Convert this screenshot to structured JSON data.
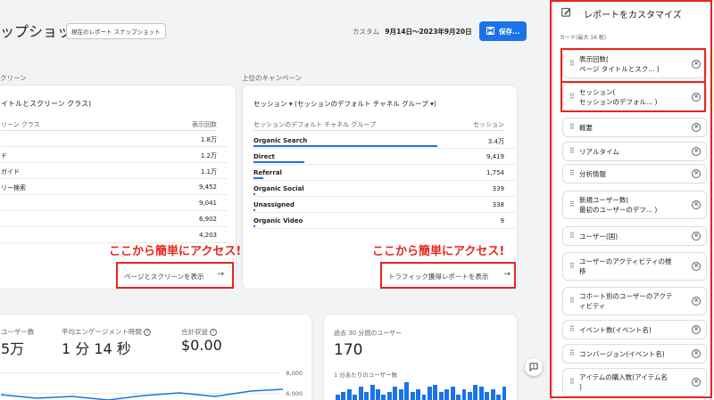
{
  "header": {
    "title": "ップショット",
    "chip": "現在のレポート スナップショット",
    "date_prefix": "カスタム",
    "date_range": "9月14日～2023年9月20日",
    "save_label": "保存..."
  },
  "pages_card": {
    "section_label": "クリーン",
    "metric_title": "イトルとスクリーン クラス)",
    "col_left": "リーン クラス",
    "col_right": "表示回数",
    "rows": [
      {
        "label": "",
        "value": "1.8万"
      },
      {
        "label": "ド",
        "value": "1.2万"
      },
      {
        "label": "ガイド",
        "value": "1.1万"
      },
      {
        "label": "リー検索",
        "value": "9,452"
      },
      {
        "label": "",
        "value": "9,041"
      },
      {
        "label": "",
        "value": "6,902"
      },
      {
        "label": "",
        "value": "4,203"
      }
    ],
    "link_label": "ページとスクリーンを表示"
  },
  "campaign_card": {
    "section_label": "上位のキャンペーン",
    "metric_title": "セッション ▾ (セッションのデフォルト チャネル グループ ▾)",
    "col_left": "セッションのデフォルト チャネル グループ",
    "col_right": "セッション",
    "rows": [
      {
        "label": "Organic Search",
        "value": "3.4万",
        "share": 0.98
      },
      {
        "label": "Direct",
        "value": "9,419",
        "share": 0.27
      },
      {
        "label": "Referral",
        "value": "1,754",
        "share": 0.05
      },
      {
        "label": "Organic Social",
        "value": "339",
        "share": 0.01
      },
      {
        "label": "Unassigned",
        "value": "338",
        "share": 0.01
      },
      {
        "label": "Organic Video",
        "value": "9",
        "share": 0.003
      }
    ],
    "link_label": "トラフィック獲得レポートを表示"
  },
  "annotation": {
    "text": "ここから簡単にアクセス!"
  },
  "metrics_card": {
    "m1_label": "ユーザー数",
    "m1_value": "5万",
    "m2_label": "平均エンゲージメント時間",
    "m2_value": "1 分 14 秒",
    "m3_label": "合計収益",
    "m3_value": "$0.00",
    "axis_top": "8,000",
    "axis_bottom": "6,000"
  },
  "users_card": {
    "label": "過去 30 分間のユーザー",
    "value": "170",
    "sub_label": "1 分あたりのユーザー数",
    "per_minute": [
      3,
      4,
      5,
      3,
      6,
      4,
      7,
      5,
      3,
      4,
      6,
      5,
      8,
      4,
      5,
      3,
      6,
      7,
      4,
      5,
      6,
      3,
      5,
      4,
      7,
      6,
      4,
      5,
      3,
      6
    ]
  },
  "panel": {
    "title": "レポートをカスタマイズ",
    "cards_label": "カード(最大 16 枚)",
    "items": [
      {
        "line1": "表示回数(",
        "line2": "ページ タイトルとスク... )"
      },
      {
        "line1": "セッション(",
        "line2": "セッションのデフォル... )"
      },
      {
        "line1": "概要",
        "line2": ""
      },
      {
        "line1": "リアルタイム",
        "line2": ""
      },
      {
        "line1": "分析情報",
        "line2": ""
      },
      {
        "line1": "新規ユーザー数(",
        "line2": "最初のユーザーのデフ... )"
      },
      {
        "line1": "ユーザー(国)",
        "line2": ""
      },
      {
        "line1": "ユーザーのアクティビティの推",
        "line2": "移"
      },
      {
        "line1": "コホート別のユーザーのアクテ",
        "line2": "ィビティ"
      },
      {
        "line1": "イベント数(イベント名)",
        "line2": ""
      },
      {
        "line1": "コンバージョン(イベント名)",
        "line2": ""
      },
      {
        "line1": "アイテムの購入数(アイテム名",
        "line2": ")"
      }
    ]
  },
  "colors": {
    "accent": "#1a73e8",
    "annotation_red": "#e8261d"
  }
}
